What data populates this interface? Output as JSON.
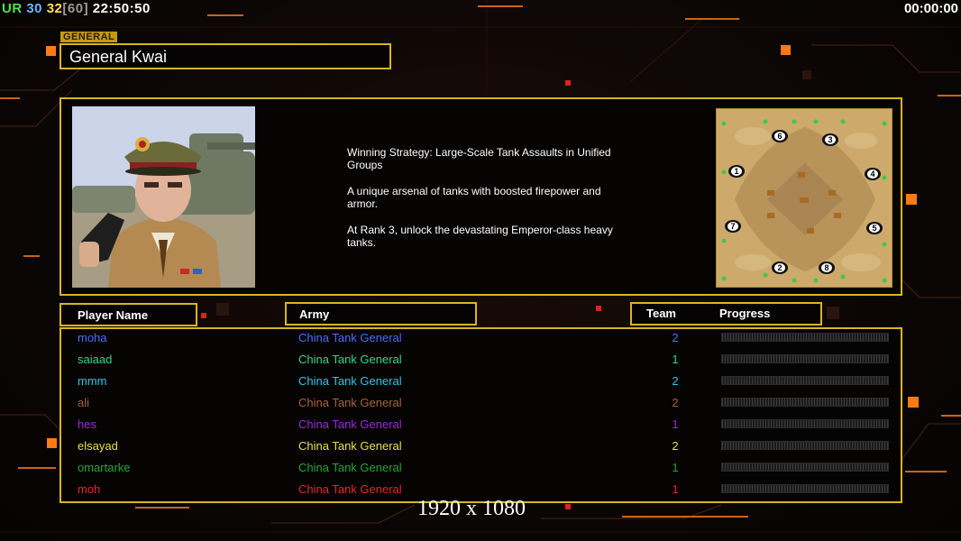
{
  "hud": {
    "ur_label": "UR",
    "num1": "30",
    "num2": "32",
    "num3": "[60]",
    "clock": "22:50:50",
    "timer": "00:00:00"
  },
  "general": {
    "tag": "GENERAL",
    "name": "General Kwai",
    "portrait_icon": "general-portrait",
    "strategy": [
      "Winning Strategy: Large-Scale Tank Assaults in Unified\n Groups",
      "A unique arsenal of tanks with boosted firepower and\n armor.",
      "At Rank 3, unlock the devastating Emperor-class heavy\n tanks."
    ]
  },
  "map": {
    "icon": "minimap",
    "start_positions": [
      "1",
      "2",
      "3",
      "4",
      "5",
      "6",
      "7",
      "8"
    ]
  },
  "table": {
    "headers": {
      "player": "Player Name",
      "army": "Army",
      "team": "Team",
      "progress": "Progress"
    },
    "rows": [
      {
        "name": "moha",
        "army": "China Tank General",
        "team": "2",
        "color": "#4a6cff"
      },
      {
        "name": "saiaad",
        "army": "China Tank General",
        "team": "1",
        "color": "#33d98a"
      },
      {
        "name": "mmm",
        "army": "China Tank General",
        "team": "2",
        "color": "#2ec6e6"
      },
      {
        "name": "ali",
        "army": "China Tank General",
        "team": "2",
        "color": "#a5643a"
      },
      {
        "name": "hes",
        "army": "China Tank General",
        "team": "1",
        "color": "#9a2ad6"
      },
      {
        "name": "elsayad",
        "army": "China Tank General",
        "team": "2",
        "color": "#e6e04a"
      },
      {
        "name": "omartarke",
        "army": "China Tank General",
        "team": "1",
        "color": "#22a833"
      },
      {
        "name": "moh",
        "army": "China Tank General",
        "team": "1",
        "color": "#e62828"
      }
    ]
  },
  "resolution_label": "1920 x 1080"
}
